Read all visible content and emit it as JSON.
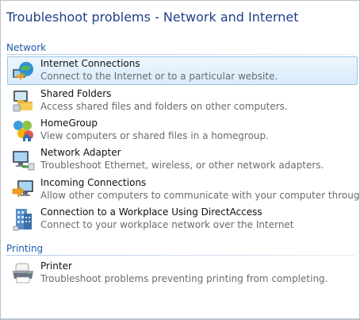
{
  "page_title": "Troubleshoot problems - Network and Internet",
  "sections": [
    {
      "name": "Network",
      "items": [
        {
          "title": "Internet Connections",
          "desc": "Connect to the Internet or to a particular website.",
          "icon": "globe-icon",
          "selected": true
        },
        {
          "title": "Shared Folders",
          "desc": "Access shared files and folders on other computers.",
          "icon": "shared-folder-icon"
        },
        {
          "title": "HomeGroup",
          "desc": "View computers or shared files in a homegroup.",
          "icon": "homegroup-icon"
        },
        {
          "title": "Network Adapter",
          "desc": "Troubleshoot Ethernet, wireless, or other network adapters.",
          "icon": "network-adapter-icon"
        },
        {
          "title": "Incoming Connections",
          "desc": "Allow other computers to communicate with your computer through Wir",
          "icon": "incoming-connections-icon"
        },
        {
          "title": "Connection to a Workplace Using DirectAccess",
          "desc": "Connect to your workplace network over the Internet",
          "icon": "workplace-building-icon"
        }
      ]
    },
    {
      "name": "Printing",
      "items": [
        {
          "title": "Printer",
          "desc": "Troubleshoot problems preventing printing from completing.",
          "icon": "printer-icon"
        }
      ]
    }
  ],
  "colors": {
    "title": "#1e3f87",
    "section": "#1e5aa8",
    "selection_border": "#9ec6ec"
  }
}
